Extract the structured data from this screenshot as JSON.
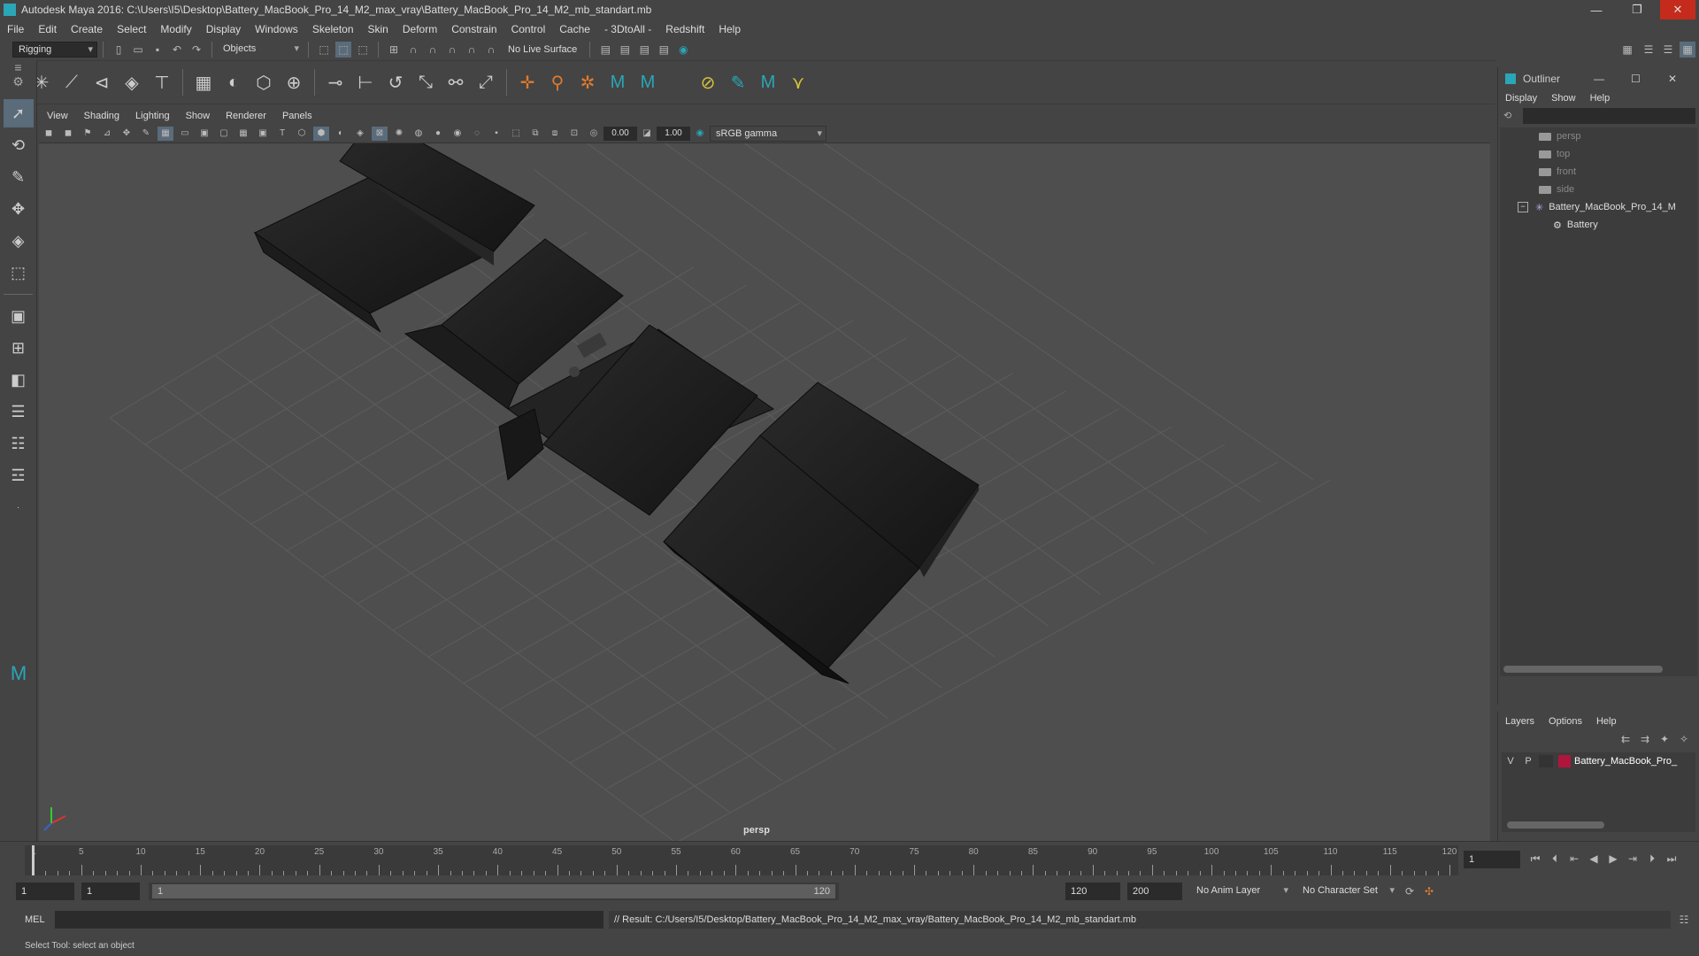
{
  "window": {
    "title": "Autodesk Maya 2016: C:\\Users\\I5\\Desktop\\Battery_MacBook_Pro_14_M2_max_vray\\Battery_MacBook_Pro_14_M2_mb_standart.mb",
    "minimize": "—",
    "restore": "❐",
    "close": "✕"
  },
  "menubar": [
    "File",
    "Edit",
    "Create",
    "Select",
    "Modify",
    "Display",
    "Windows",
    "Skeleton",
    "Skin",
    "Deform",
    "Constrain",
    "Control",
    "Cache",
    "- 3DtoAll -",
    "Redshift",
    "Help"
  ],
  "toolbar": {
    "mode": "Rigging",
    "selection_mode": "Objects",
    "live_surface": "No Live Surface"
  },
  "panel_menu": [
    "View",
    "Shading",
    "Lighting",
    "Show",
    "Renderer",
    "Panels"
  ],
  "viewport": {
    "exposure": "0.00",
    "gamma": "1.00",
    "color_space": "sRGB gamma",
    "camera_label": "persp"
  },
  "outliner": {
    "title": "Outliner",
    "menu": [
      "Display",
      "Show",
      "Help"
    ],
    "items": [
      {
        "label": "persp",
        "type": "camera"
      },
      {
        "label": "top",
        "type": "camera"
      },
      {
        "label": "front",
        "type": "camera"
      },
      {
        "label": "side",
        "type": "camera"
      },
      {
        "label": "Battery_MacBook_Pro_14_M",
        "type": "group"
      },
      {
        "label": "Battery",
        "type": "mesh"
      }
    ]
  },
  "layers": {
    "menu": [
      "Layers",
      "Options",
      "Help"
    ],
    "row": {
      "v": "V",
      "p": "P",
      "name": "Battery_MacBook_Pro_",
      "color": "#b0163c"
    }
  },
  "timeline": {
    "ticks": [
      "1",
      "5",
      "10",
      "15",
      "20",
      "25",
      "30",
      "35",
      "40",
      "45",
      "50",
      "55",
      "60",
      "65",
      "70",
      "75",
      "80",
      "85",
      "90",
      "95",
      "100",
      "105",
      "110",
      "115",
      "120"
    ],
    "current_frame": "1"
  },
  "range": {
    "start": "1",
    "playback_start": "1",
    "slider_start": "1",
    "slider_end": "120",
    "playback_end": "120",
    "end": "200",
    "anim_layer": "No Anim Layer",
    "character_set": "No Character Set"
  },
  "command": {
    "lang": "MEL",
    "result": "// Result: C:/Users/I5/Desktop/Battery_MacBook_Pro_14_M2_max_vray/Battery_MacBook_Pro_14_M2_mb_standart.mb"
  },
  "help_line": "Select Tool: select an object",
  "colors": {
    "accent": "#5a6b7a",
    "bg": "#444444",
    "viewport": "#4e4e4e",
    "maya_logo": "#2aa6b7"
  }
}
